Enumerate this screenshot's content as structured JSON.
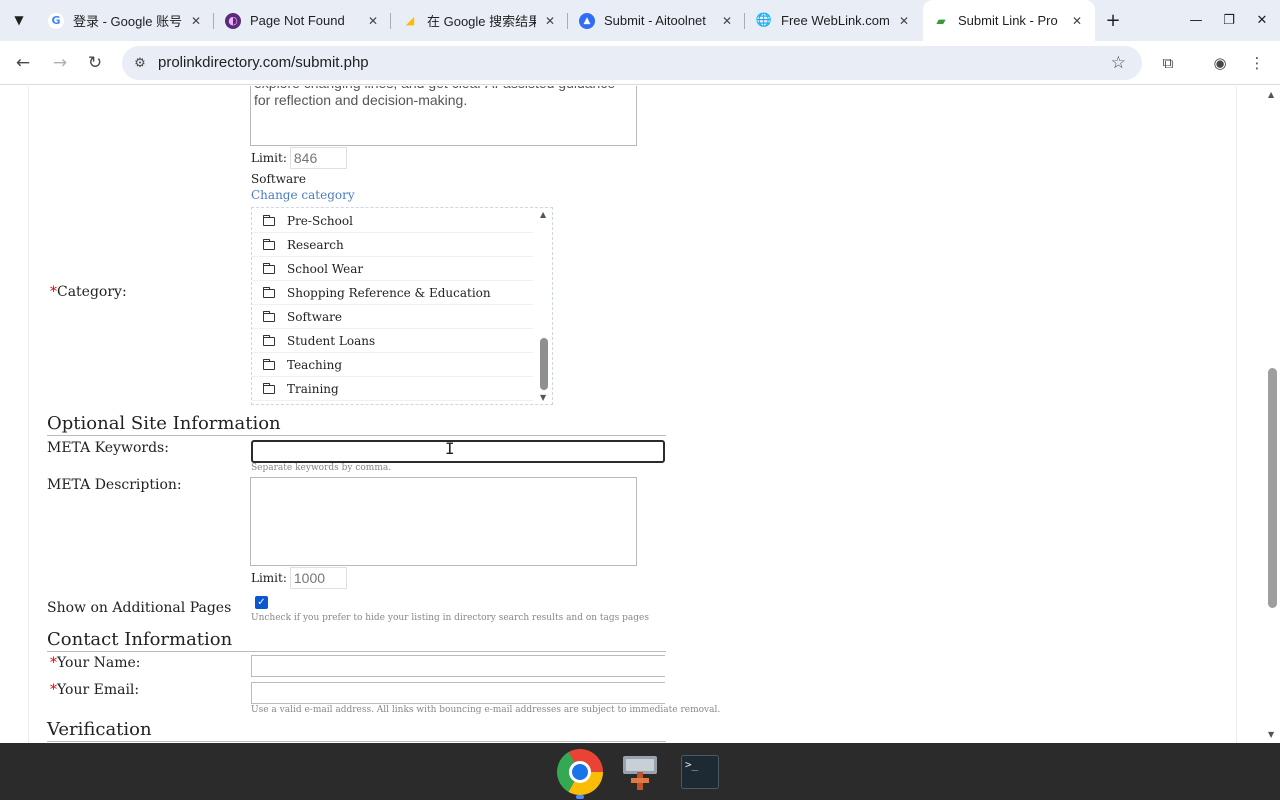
{
  "browser": {
    "tabs": [
      {
        "title": "登录 - Google 账号",
        "favicon": "google-g-icon"
      },
      {
        "title": "Page Not Found",
        "favicon": "purple-circle-icon"
      },
      {
        "title": "在 Google 搜索结果",
        "favicon": "google-ads-icon"
      },
      {
        "title": "Submit - Aitoolnet",
        "favicon": "aitoolnet-icon"
      },
      {
        "title": "Free WebLink.com",
        "favicon": "globe-icon"
      },
      {
        "title": "Submit Link - Pro",
        "favicon": "speech-bubble-icon",
        "active": true
      }
    ],
    "url": "prolinkdirectory.com/submit.php"
  },
  "form": {
    "description_text": "explore changing lines, and get clear AI-assisted guidance for reflection and decision-making.",
    "description_limit_label": "Limit:",
    "description_limit_value": "846",
    "selected_category": "Software",
    "change_category_link": "Change category",
    "category_label": "Category:",
    "required_marker": "*",
    "categories": [
      "Pre-School",
      "Research",
      "School Wear",
      "Shopping Reference & Education",
      "Software",
      "Student Loans",
      "Teaching",
      "Training"
    ],
    "optional_section_title": "Optional Site Information",
    "meta_keywords_label": "META Keywords:",
    "meta_keywords_value": "",
    "meta_keywords_hint": "Separate keywords by comma.",
    "meta_description_label": "META Description:",
    "meta_description_value": "",
    "meta_limit_label": "Limit:",
    "meta_limit_value": "1000",
    "show_pages_label": "Show on Additional Pages",
    "show_pages_checked": true,
    "show_pages_hint": "Uncheck if you prefer to hide your listing in directory search results and on tags pages",
    "contact_section_title": "Contact Information",
    "your_name_label": "Your Name:",
    "your_name_value": "",
    "your_email_label": "Your Email:",
    "your_email_value": "",
    "email_hint": "Use a valid e-mail address. All links with bouncing e-mail addresses are subject to immediate removal.",
    "verification_section_title": "Verification"
  },
  "colors": {
    "required": "#dd0000",
    "link": "#4a7bc4",
    "checkbox": "#0b57d0"
  }
}
